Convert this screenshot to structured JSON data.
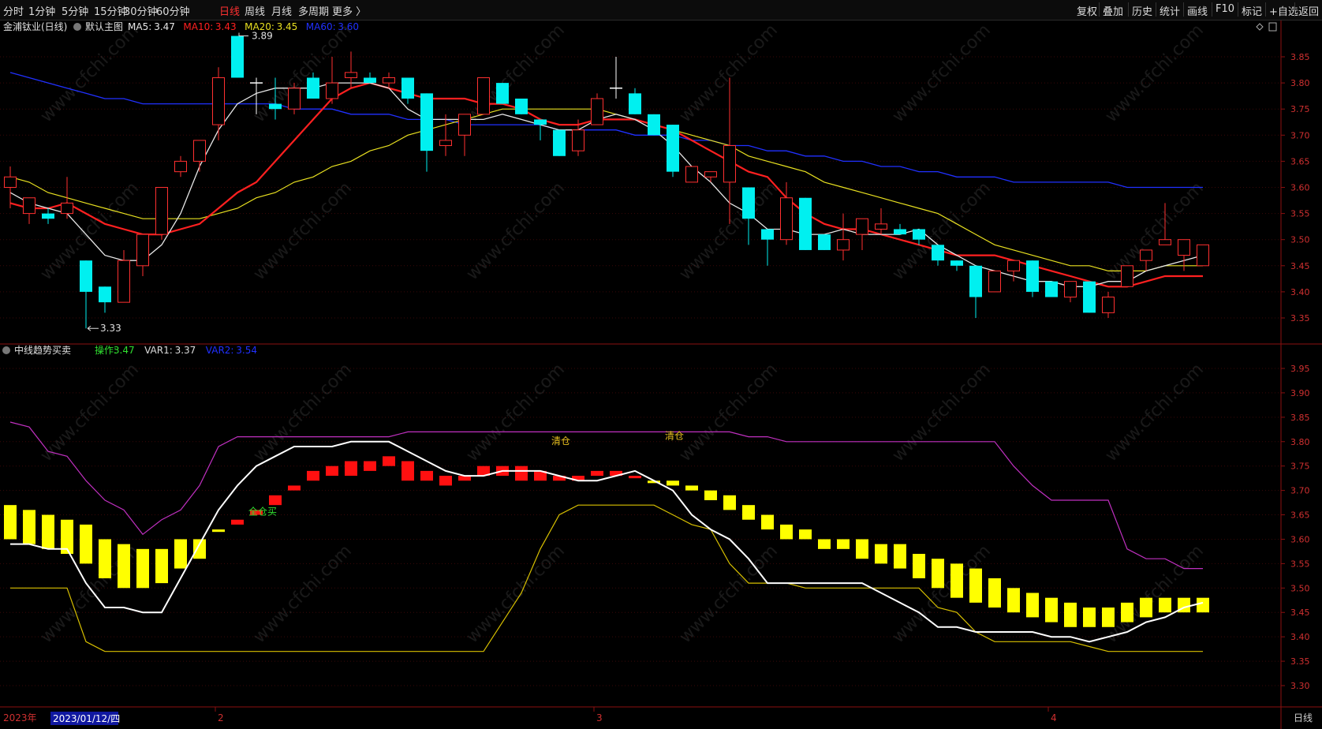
{
  "toolbar": {
    "periods": [
      {
        "label": "分时",
        "active": false
      },
      {
        "label": "1分钟",
        "active": false
      },
      {
        "label": "5分钟",
        "active": false
      },
      {
        "label": "15分钟",
        "active": false
      },
      {
        "label": "30分钟",
        "active": false
      },
      {
        "label": "60分钟",
        "active": false
      },
      {
        "label": "日线",
        "active": true
      },
      {
        "label": "周线",
        "active": false
      },
      {
        "label": "月线",
        "active": false
      },
      {
        "label": "多周期",
        "active": false
      },
      {
        "label": "更多 〉",
        "active": false
      }
    ],
    "right_buttons": [
      "复权",
      "叠加",
      "历史",
      "统计",
      "画线",
      "F10",
      "标记",
      "+自选",
      "返回"
    ]
  },
  "main_panel": {
    "stock_label": "金浦钛业(日线)",
    "template_label": "默认主图",
    "indicators": [
      {
        "label": "MA5:",
        "value": "3.47",
        "color": "#e8e8e8"
      },
      {
        "label": "MA10:",
        "value": "3.43",
        "color": "#ff2020"
      },
      {
        "label": "MA20:",
        "value": "3.45",
        "color": "#e8e020"
      },
      {
        "label": "MA60:",
        "value": "3.60",
        "color": "#2030ff"
      }
    ],
    "high_marker": "3.89",
    "low_marker": "3.33",
    "y_ticks": [
      "3.85",
      "3.80",
      "3.75",
      "3.70",
      "3.65",
      "3.60",
      "3.55",
      "3.50",
      "3.45",
      "3.40",
      "3.35"
    ]
  },
  "sub_panel": {
    "title": "中线趋势买卖",
    "indicators": [
      {
        "label": "操作:",
        "value": "3.47",
        "color": "#30e030"
      },
      {
        "label": "VAR1:",
        "value": "3.37",
        "color": "#dcdcdc"
      },
      {
        "label": "VAR2:",
        "value": "3.54",
        "color": "#2030ff"
      }
    ],
    "signals": [
      {
        "text": "全仓买",
        "idx": 13,
        "price": 3.65,
        "color": "#30e030"
      },
      {
        "text": "清仓",
        "idx": 29,
        "price": 3.795,
        "color": "#e8c020"
      },
      {
        "text": "清仓",
        "idx": 35,
        "price": 3.805,
        "color": "#e8c020"
      }
    ],
    "y_ticks": [
      "3.95",
      "3.90",
      "3.85",
      "3.80",
      "3.75",
      "3.70",
      "3.65",
      "3.60",
      "3.55",
      "3.50",
      "3.45",
      "3.40",
      "3.35",
      "3.30"
    ]
  },
  "x_axis": {
    "year_label": "2023年",
    "date_label": "2023/01/12/四",
    "month_labels": [
      {
        "label": "2",
        "idx": 11
      },
      {
        "label": "3",
        "idx": 31
      },
      {
        "label": "4",
        "idx": 55
      }
    ],
    "period_label": "日线"
  },
  "watermark": "www.cfchi.com",
  "chart_data": {
    "type": "candlestick",
    "candles": [
      {
        "o": 3.6,
        "h": 3.64,
        "l": 3.56,
        "c": 3.62
      },
      {
        "o": 3.55,
        "h": 3.58,
        "l": 3.53,
        "c": 3.58
      },
      {
        "o": 3.55,
        "h": 3.56,
        "l": 3.53,
        "c": 3.54
      },
      {
        "o": 3.55,
        "h": 3.62,
        "l": 3.54,
        "c": 3.57
      },
      {
        "o": 3.46,
        "h": 3.46,
        "l": 3.33,
        "c": 3.4
      },
      {
        "o": 3.41,
        "h": 3.41,
        "l": 3.36,
        "c": 3.38
      },
      {
        "o": 3.38,
        "h": 3.48,
        "l": 3.38,
        "c": 3.46
      },
      {
        "o": 3.45,
        "h": 3.51,
        "l": 3.43,
        "c": 3.51
      },
      {
        "o": 3.51,
        "h": 3.6,
        "l": 3.5,
        "c": 3.6
      },
      {
        "o": 3.63,
        "h": 3.66,
        "l": 3.62,
        "c": 3.65
      },
      {
        "o": 3.65,
        "h": 3.69,
        "l": 3.63,
        "c": 3.69
      },
      {
        "o": 3.72,
        "h": 3.83,
        "l": 3.69,
        "c": 3.81
      },
      {
        "o": 3.89,
        "h": 3.89,
        "l": 3.81,
        "c": 3.81
      },
      {
        "o": 3.8,
        "h": 3.81,
        "l": 3.74,
        "c": 3.8
      },
      {
        "o": 3.76,
        "h": 3.81,
        "l": 3.73,
        "c": 3.75
      },
      {
        "o": 3.75,
        "h": 3.8,
        "l": 3.74,
        "c": 3.79
      },
      {
        "o": 3.81,
        "h": 3.82,
        "l": 3.77,
        "c": 3.77
      },
      {
        "o": 3.77,
        "h": 3.85,
        "l": 3.76,
        "c": 3.8
      },
      {
        "o": 3.81,
        "h": 3.86,
        "l": 3.79,
        "c": 3.82
      },
      {
        "o": 3.81,
        "h": 3.82,
        "l": 3.8,
        "c": 3.8
      },
      {
        "o": 3.8,
        "h": 3.82,
        "l": 3.79,
        "c": 3.81
      },
      {
        "o": 3.81,
        "h": 3.81,
        "l": 3.76,
        "c": 3.77
      },
      {
        "o": 3.78,
        "h": 3.78,
        "l": 3.63,
        "c": 3.67
      },
      {
        "o": 3.68,
        "h": 3.74,
        "l": 3.66,
        "c": 3.69
      },
      {
        "o": 3.7,
        "h": 3.74,
        "l": 3.66,
        "c": 3.74
      },
      {
        "o": 3.74,
        "h": 3.81,
        "l": 3.74,
        "c": 3.81
      },
      {
        "o": 3.8,
        "h": 3.8,
        "l": 3.76,
        "c": 3.76
      },
      {
        "o": 3.77,
        "h": 3.77,
        "l": 3.74,
        "c": 3.74
      },
      {
        "o": 3.73,
        "h": 3.73,
        "l": 3.69,
        "c": 3.72
      },
      {
        "o": 3.71,
        "h": 3.71,
        "l": 3.66,
        "c": 3.66
      },
      {
        "o": 3.67,
        "h": 3.73,
        "l": 3.66,
        "c": 3.71
      },
      {
        "o": 3.72,
        "h": 3.78,
        "l": 3.72,
        "c": 3.77
      },
      {
        "o": 3.79,
        "h": 3.85,
        "l": 3.77,
        "c": 3.79
      },
      {
        "o": 3.78,
        "h": 3.79,
        "l": 3.74,
        "c": 3.74
      },
      {
        "o": 3.74,
        "h": 3.74,
        "l": 3.7,
        "c": 3.7
      },
      {
        "o": 3.72,
        "h": 3.72,
        "l": 3.62,
        "c": 3.63
      },
      {
        "o": 3.61,
        "h": 3.64,
        "l": 3.61,
        "c": 3.64
      },
      {
        "o": 3.62,
        "h": 3.63,
        "l": 3.61,
        "c": 3.63
      },
      {
        "o": 3.61,
        "h": 3.81,
        "l": 3.53,
        "c": 3.68
      },
      {
        "o": 3.6,
        "h": 3.6,
        "l": 3.49,
        "c": 3.54
      },
      {
        "o": 3.52,
        "h": 3.52,
        "l": 3.45,
        "c": 3.5
      },
      {
        "o": 3.5,
        "h": 3.61,
        "l": 3.49,
        "c": 3.58
      },
      {
        "o": 3.58,
        "h": 3.58,
        "l": 3.48,
        "c": 3.48
      },
      {
        "o": 3.51,
        "h": 3.51,
        "l": 3.48,
        "c": 3.48
      },
      {
        "o": 3.48,
        "h": 3.55,
        "l": 3.46,
        "c": 3.5
      },
      {
        "o": 3.51,
        "h": 3.53,
        "l": 3.48,
        "c": 3.54
      },
      {
        "o": 3.52,
        "h": 3.56,
        "l": 3.51,
        "c": 3.53
      },
      {
        "o": 3.52,
        "h": 3.53,
        "l": 3.51,
        "c": 3.51
      },
      {
        "o": 3.52,
        "h": 3.52,
        "l": 3.49,
        "c": 3.5
      },
      {
        "o": 3.49,
        "h": 3.49,
        "l": 3.45,
        "c": 3.46
      },
      {
        "o": 3.46,
        "h": 3.46,
        "l": 3.44,
        "c": 3.45
      },
      {
        "o": 3.45,
        "h": 3.45,
        "l": 3.35,
        "c": 3.39
      },
      {
        "o": 3.4,
        "h": 3.44,
        "l": 3.4,
        "c": 3.44
      },
      {
        "o": 3.44,
        "h": 3.46,
        "l": 3.42,
        "c": 3.46
      },
      {
        "o": 3.46,
        "h": 3.46,
        "l": 3.39,
        "c": 3.4
      },
      {
        "o": 3.42,
        "h": 3.42,
        "l": 3.39,
        "c": 3.39
      },
      {
        "o": 3.39,
        "h": 3.42,
        "l": 3.38,
        "c": 3.42
      },
      {
        "o": 3.42,
        "h": 3.42,
        "l": 3.36,
        "c": 3.36
      },
      {
        "o": 3.36,
        "h": 3.4,
        "l": 3.35,
        "c": 3.39
      },
      {
        "o": 3.41,
        "h": 3.45,
        "l": 3.41,
        "c": 3.45
      },
      {
        "o": 3.46,
        "h": 3.48,
        "l": 3.44,
        "c": 3.48
      },
      {
        "o": 3.49,
        "h": 3.57,
        "l": 3.49,
        "c": 3.5
      },
      {
        "o": 3.47,
        "h": 3.5,
        "l": 3.44,
        "c": 3.5
      },
      {
        "o": 3.45,
        "h": 3.49,
        "l": 3.45,
        "c": 3.49
      }
    ],
    "ma5": [
      3.59,
      3.57,
      3.56,
      3.55,
      3.51,
      3.47,
      3.46,
      3.46,
      3.49,
      3.55,
      3.64,
      3.71,
      3.76,
      3.78,
      3.79,
      3.79,
      3.79,
      3.8,
      3.8,
      3.8,
      3.79,
      3.75,
      3.73,
      3.73,
      3.73,
      3.73,
      3.74,
      3.73,
      3.72,
      3.71,
      3.71,
      3.73,
      3.74,
      3.73,
      3.71,
      3.68,
      3.64,
      3.61,
      3.57,
      3.55,
      3.52,
      3.52,
      3.51,
      3.51,
      3.52,
      3.51,
      3.51,
      3.51,
      3.52,
      3.49,
      3.47,
      3.45,
      3.44,
      3.43,
      3.42,
      3.42,
      3.41,
      3.41,
      3.42,
      3.42,
      3.44,
      3.45,
      3.46,
      3.47
    ],
    "ma10": [
      3.57,
      3.56,
      3.56,
      3.57,
      3.55,
      3.53,
      3.52,
      3.51,
      3.51,
      3.52,
      3.53,
      3.56,
      3.59,
      3.61,
      3.65,
      3.69,
      3.73,
      3.77,
      3.79,
      3.8,
      3.79,
      3.78,
      3.77,
      3.77,
      3.77,
      3.76,
      3.76,
      3.75,
      3.73,
      3.72,
      3.72,
      3.73,
      3.73,
      3.73,
      3.72,
      3.71,
      3.69,
      3.67,
      3.65,
      3.63,
      3.62,
      3.58,
      3.55,
      3.53,
      3.52,
      3.52,
      3.51,
      3.5,
      3.49,
      3.48,
      3.47,
      3.47,
      3.47,
      3.46,
      3.45,
      3.44,
      3.43,
      3.42,
      3.41,
      3.41,
      3.42,
      3.43,
      3.43,
      3.43
    ],
    "ma20": [
      3.62,
      3.61,
      3.59,
      3.58,
      3.57,
      3.56,
      3.55,
      3.54,
      3.54,
      3.54,
      3.54,
      3.55,
      3.56,
      3.58,
      3.59,
      3.61,
      3.62,
      3.64,
      3.65,
      3.67,
      3.68,
      3.7,
      3.71,
      3.72,
      3.73,
      3.74,
      3.75,
      3.75,
      3.75,
      3.75,
      3.75,
      3.75,
      3.74,
      3.73,
      3.72,
      3.71,
      3.7,
      3.69,
      3.68,
      3.66,
      3.65,
      3.64,
      3.63,
      3.61,
      3.6,
      3.59,
      3.58,
      3.57,
      3.56,
      3.55,
      3.53,
      3.51,
      3.49,
      3.48,
      3.47,
      3.46,
      3.45,
      3.45,
      3.44,
      3.44,
      3.44,
      3.45,
      3.45,
      3.45
    ],
    "ma60": [
      3.82,
      3.81,
      3.8,
      3.79,
      3.78,
      3.77,
      3.77,
      3.76,
      3.76,
      3.76,
      3.76,
      3.76,
      3.76,
      3.76,
      3.76,
      3.75,
      3.75,
      3.75,
      3.74,
      3.74,
      3.74,
      3.73,
      3.73,
      3.73,
      3.72,
      3.72,
      3.72,
      3.72,
      3.72,
      3.71,
      3.71,
      3.71,
      3.71,
      3.7,
      3.7,
      3.7,
      3.69,
      3.69,
      3.68,
      3.68,
      3.67,
      3.67,
      3.66,
      3.66,
      3.65,
      3.65,
      3.64,
      3.64,
      3.63,
      3.63,
      3.62,
      3.62,
      3.62,
      3.61,
      3.61,
      3.61,
      3.61,
      3.61,
      3.61,
      3.6,
      3.6,
      3.6,
      3.6,
      3.6
    ],
    "sub": {
      "bars_open": [
        3.67,
        3.66,
        3.65,
        3.64,
        3.63,
        3.6,
        3.59,
        3.58,
        3.58,
        3.6,
        3.6,
        3.62,
        3.64,
        3.66,
        3.69,
        3.71,
        3.74,
        3.75,
        3.76,
        3.76,
        3.77,
        3.76,
        3.74,
        3.73,
        3.73,
        3.75,
        3.75,
        3.75,
        3.74,
        3.73,
        3.73,
        3.74,
        3.74,
        3.73,
        3.72,
        3.72,
        3.71,
        3.7,
        3.69,
        3.67,
        3.65,
        3.63,
        3.62,
        3.6,
        3.6,
        3.6,
        3.59,
        3.59,
        3.57,
        3.56,
        3.55,
        3.54,
        3.52,
        3.5,
        3.49,
        3.48,
        3.47,
        3.46,
        3.46,
        3.47,
        3.48,
        3.48,
        3.48,
        3.48
      ],
      "bars_close": [
        3.6,
        3.59,
        3.58,
        3.57,
        3.55,
        3.52,
        3.5,
        3.5,
        3.51,
        3.54,
        3.56,
        3.615,
        3.63,
        3.65,
        3.67,
        3.7,
        3.72,
        3.73,
        3.73,
        3.74,
        3.75,
        3.72,
        3.72,
        3.71,
        3.72,
        3.73,
        3.73,
        3.72,
        3.72,
        3.72,
        3.72,
        3.73,
        3.73,
        3.725,
        3.715,
        3.71,
        3.7,
        3.68,
        3.66,
        3.64,
        3.62,
        3.6,
        3.6,
        3.58,
        3.58,
        3.56,
        3.55,
        3.54,
        3.52,
        3.5,
        3.48,
        3.47,
        3.46,
        3.45,
        3.44,
        3.43,
        3.42,
        3.42,
        3.42,
        3.43,
        3.44,
        3.45,
        3.45,
        3.45
      ],
      "var1": [
        3.5,
        3.5,
        3.5,
        3.5,
        3.39,
        3.37,
        3.37,
        3.37,
        3.37,
        3.37,
        3.37,
        3.37,
        3.37,
        3.37,
        3.37,
        3.37,
        3.37,
        3.37,
        3.37,
        3.37,
        3.37,
        3.37,
        3.37,
        3.37,
        3.37,
        3.37,
        3.43,
        3.49,
        3.58,
        3.65,
        3.67,
        3.67,
        3.67,
        3.67,
        3.67,
        3.65,
        3.63,
        3.62,
        3.55,
        3.51,
        3.51,
        3.51,
        3.5,
        3.5,
        3.5,
        3.5,
        3.5,
        3.5,
        3.5,
        3.46,
        3.45,
        3.41,
        3.39,
        3.39,
        3.39,
        3.39,
        3.39,
        3.38,
        3.37,
        3.37,
        3.37,
        3.37,
        3.37,
        3.37
      ],
      "var2": [
        3.84,
        3.83,
        3.78,
        3.77,
        3.72,
        3.68,
        3.66,
        3.61,
        3.64,
        3.66,
        3.71,
        3.79,
        3.81,
        3.81,
        3.81,
        3.81,
        3.81,
        3.81,
        3.81,
        3.81,
        3.81,
        3.82,
        3.82,
        3.82,
        3.82,
        3.82,
        3.82,
        3.82,
        3.82,
        3.82,
        3.82,
        3.82,
        3.82,
        3.82,
        3.82,
        3.82,
        3.82,
        3.82,
        3.82,
        3.81,
        3.81,
        3.8,
        3.8,
        3.8,
        3.8,
        3.8,
        3.8,
        3.8,
        3.8,
        3.8,
        3.8,
        3.8,
        3.8,
        3.75,
        3.71,
        3.68,
        3.68,
        3.68,
        3.68,
        3.58,
        3.56,
        3.56,
        3.54,
        3.54
      ],
      "line": [
        3.59,
        3.59,
        3.58,
        3.58,
        3.51,
        3.46,
        3.46,
        3.45,
        3.45,
        3.52,
        3.59,
        3.66,
        3.71,
        3.75,
        3.77,
        3.79,
        3.79,
        3.79,
        3.8,
        3.8,
        3.8,
        3.78,
        3.76,
        3.74,
        3.73,
        3.73,
        3.74,
        3.74,
        3.74,
        3.73,
        3.72,
        3.72,
        3.73,
        3.74,
        3.72,
        3.7,
        3.65,
        3.62,
        3.6,
        3.56,
        3.51,
        3.51,
        3.51,
        3.51,
        3.51,
        3.51,
        3.49,
        3.47,
        3.45,
        3.42,
        3.42,
        3.41,
        3.41,
        3.41,
        3.41,
        3.4,
        3.4,
        3.39,
        3.4,
        3.41,
        3.43,
        3.44,
        3.46,
        3.47
      ]
    }
  }
}
